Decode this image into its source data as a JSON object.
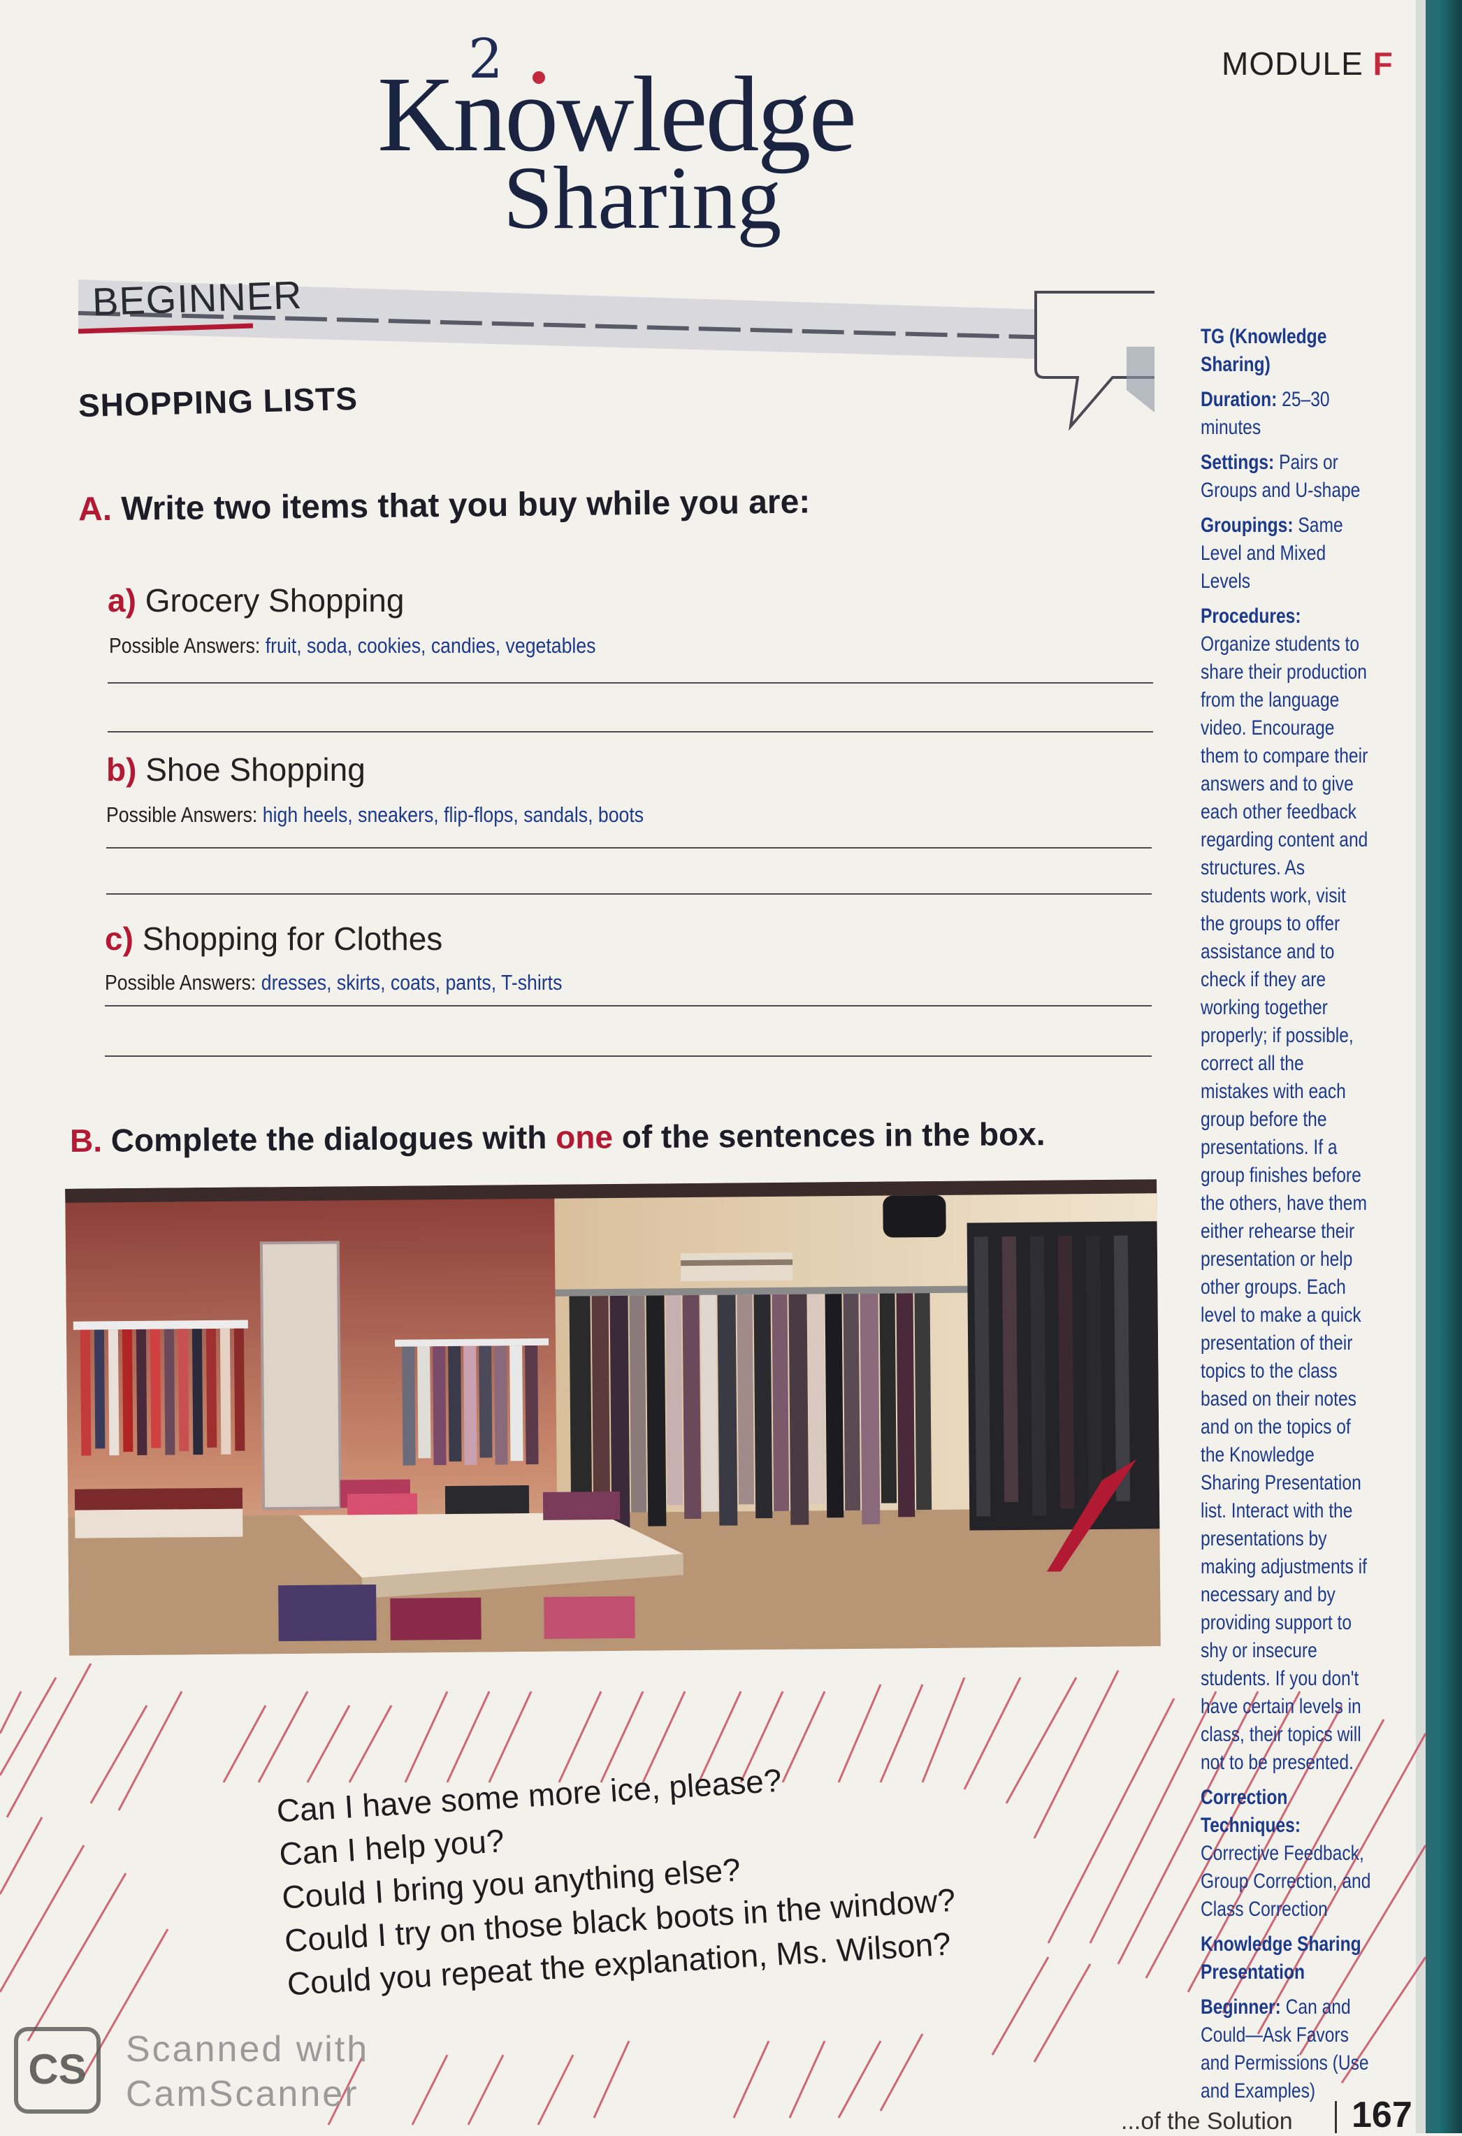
{
  "header": {
    "logo_number": "2",
    "logo_word1": "Knowledge",
    "logo_word2": "Sharing",
    "module_label": "MODULE",
    "module_letter": "F"
  },
  "banner": {
    "label": "BEGINNER"
  },
  "section_title": "SHOPPING LISTS",
  "section_a": {
    "letter": "A.",
    "instruction": "Write two items that you buy while you are:",
    "items": [
      {
        "letter": "a)",
        "label": "Grocery Shopping",
        "answer_label": "Possible Answers:",
        "answer": "fruit, soda, cookies, candies, vegetables"
      },
      {
        "letter": "b)",
        "label": "Shoe Shopping",
        "answer_label": "Possible Answers:",
        "answer": "high heels, sneakers, flip-flops, sandals, boots"
      },
      {
        "letter": "c)",
        "label": "Shopping for Clothes",
        "answer_label": "Possible Answers:",
        "answer": "dresses, skirts, coats, pants, T-shirts"
      }
    ]
  },
  "section_b": {
    "letter": "B.",
    "instruction_before": "Complete the dialogues with ",
    "instruction_highlight": "one",
    "instruction_after": " of the sentences in the box."
  },
  "sentence_box": [
    "Can I have some more ice, please?",
    "Can I help you?",
    "Could I bring you anything else?",
    "Could I try on those black boots in the window?",
    "Could you repeat the explanation, Ms. Wilson?"
  ],
  "sidebar": {
    "tg_title": "TG (Knowledge Sharing)",
    "duration_label": "Duration:",
    "duration": "25–30 minutes",
    "settings_label": "Settings:",
    "settings": "Pairs or Groups and U-shape",
    "groupings_label": "Groupings:",
    "groupings": "Same Level and Mixed Levels",
    "procedures_label": "Procedures:",
    "procedures": "Organize students to share their production from the language video. Encourage them to compare their answers and to give each other feedback regarding content and structures. As students work, visit the groups to offer assistance and to check if they are working together properly; if possible, correct all the mistakes with each group before the presentations. If a group finishes before the others, have them either rehearse their presentation or help other groups. Each level to make a quick presentation of their topics to the class based on their notes and on the topics of the Knowledge Sharing Presentation list. Interact with the presentations by making adjustments if necessary and by providing support to shy or insecure students. If you don't have certain levels in class, their topics will not to be presented.",
    "correction_label": "Correction Techniques:",
    "correction": "Corrective Feedback, Group Correction, and Class Correction",
    "ksp_title": "Knowledge Sharing Presentation",
    "beginner_label": "Beginner:",
    "beginner": "Can and Could—Ask Favors and Permissions (Use and Examples)"
  },
  "footer": {
    "text": "...of the Solution",
    "page_number": "167"
  },
  "watermark": {
    "logo": "CS",
    "line1": "Scanned with",
    "line2": "CamScanner"
  },
  "colors": {
    "accent_red": "#b11a32",
    "answer_blue": "#1d3a8a",
    "teal_edge": "#1f6d74"
  }
}
